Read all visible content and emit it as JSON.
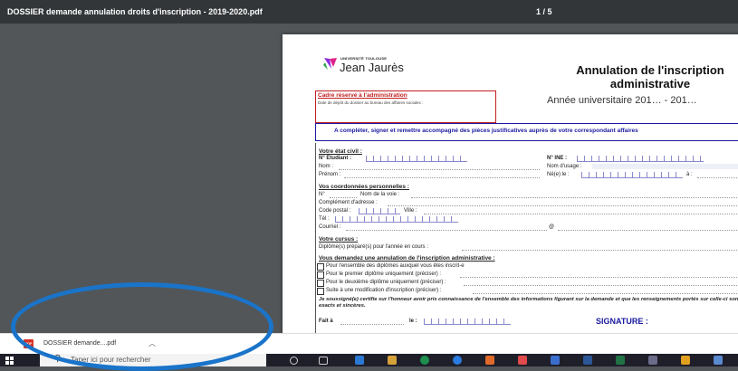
{
  "viewer": {
    "file_title": "DOSSIER demande annulation droits d'inscription - 2019-2020.pdf",
    "page_indicator": "1 / 5"
  },
  "document": {
    "logo": {
      "top": "UNIVERSITÉ TOULOUSE",
      "main": "Jean Jaurès"
    },
    "title": "Annulation de l'inscription administrative",
    "academic_year": "Année universitaire 201… - 201…",
    "reserved": {
      "title": "Cadre réservé à l'administration",
      "text": "Date de dépôt du dossier au bureau des affaires sociales :"
    },
    "instructions": "A compléter, signer et remettre accompagné des pièces justificatives auprès de votre correspondant affaires",
    "etat_civil": {
      "heading": "Votre état civil :",
      "student_no": "N° Etudiant :",
      "ine": "N° INE :",
      "nom": "Nom :",
      "nom_usage": "Nom d'usage :",
      "prenom": "Prénom :",
      "ne_le": "Né(e) le :",
      "a": "à :"
    },
    "coordonnees": {
      "heading": "Vos coordonnées personnelles :",
      "numero": "N°",
      "voie": "Nom de la voie :",
      "complement": "Complément d'adresse :",
      "code_postal": "Code postal :",
      "ville": "Ville :",
      "tel": "Tél :",
      "courriel": "Courriel :",
      "at": "@"
    },
    "cursus": {
      "heading": "Votre cursus :",
      "diplome": "Diplôme(s) préparé(s) pour l'année en cours :"
    },
    "demande": {
      "heading": "Vous demandez une annulation de l'inscription administrative :",
      "options": [
        "Pour l'ensemble des diplômes auxquel vous êtes inscrit-e",
        "Pour le premier diplôme uniquement (préciser) :",
        "Pour le deuxième diplôme uniquement (préciser) :",
        "Suite à une modification d'inscription (préciser) :"
      ]
    },
    "certification": "Je soussigné(e) certifie sur l'honneur avoir pris connaissance de l'ensemble des informations figurant sur la demande et que les renseignements portés sur celle-ci sont exacts et sincères.",
    "fait_a": "Fait à",
    "le": "le :",
    "signature": "SIGNATURE :"
  },
  "downloads": {
    "file_name": "DOSSIER demande....pdf",
    "file_type": "PDF"
  },
  "taskbar": {
    "search_placeholder": "Taper ici pour rechercher"
  },
  "colors": {
    "viewer_bar": "#323639",
    "viewer_bg": "#525659",
    "reserved_red": "#c21f1f",
    "instructions_blue": "#1a1aa0",
    "highlight_ring": "#1a74c9",
    "taskbar": "#1f1f2a"
  },
  "icons": [
    "pdf-icon",
    "chevron-up-icon",
    "windows-start-icon",
    "search-icon",
    "cortana-icon",
    "task-view-icon",
    "edge-icon",
    "file-explorer-icon",
    "chrome-icon",
    "store-icon",
    "mail-icon",
    "app-icon"
  ]
}
